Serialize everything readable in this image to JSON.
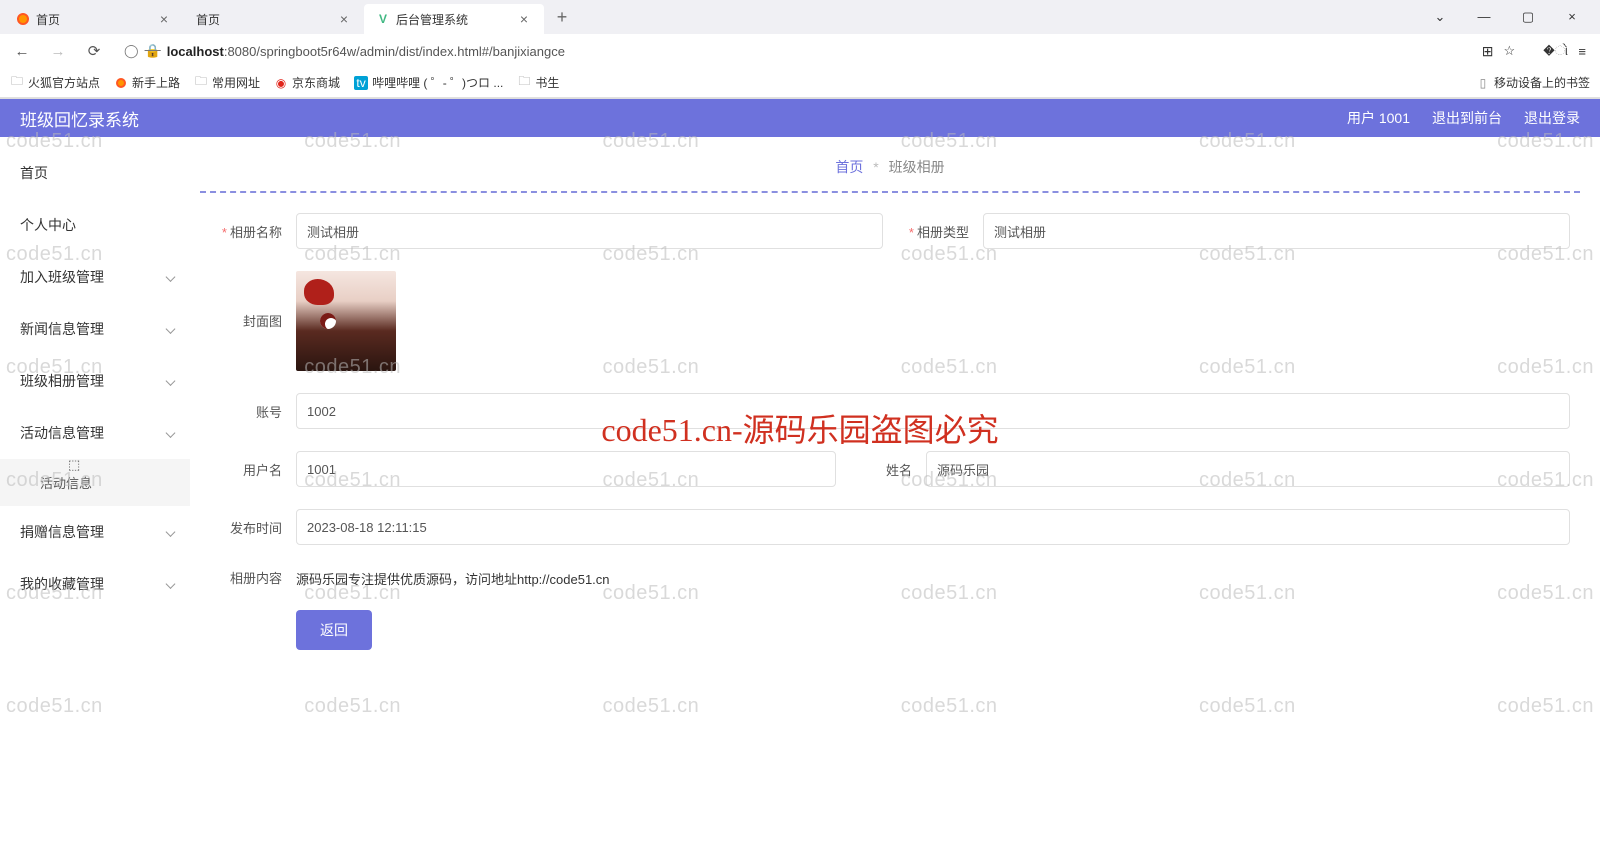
{
  "browser": {
    "tabs": [
      {
        "title": "首页",
        "favicon": "ff"
      },
      {
        "title": "首页",
        "favicon": "none"
      },
      {
        "title": "后台管理系统",
        "favicon": "vue",
        "active": true
      }
    ],
    "url_host": "localhost",
    "url_path": ":8080/springboot5r64w/admin/dist/index.html#/banjixiangce",
    "bookmarks": [
      {
        "label": "火狐官方站点",
        "icon": "folder"
      },
      {
        "label": "新手上路",
        "icon": "ff"
      },
      {
        "label": "常用网址",
        "icon": "folder"
      },
      {
        "label": "京东商城",
        "icon": "jd"
      },
      {
        "label": "哔哩哔哩 (  ゜- ゜)つロ ...",
        "icon": "bili"
      },
      {
        "label": "书生",
        "icon": "folder"
      }
    ],
    "mobile_bm": "移动设备上的书签"
  },
  "app": {
    "title": "班级回忆录系统",
    "user_label": "用户 1001",
    "exit_front": "退出到前台",
    "logout": "退出登录"
  },
  "sidebar": {
    "items": [
      {
        "label": "首页"
      },
      {
        "label": "个人中心"
      },
      {
        "label": "加入班级管理",
        "sub": true
      },
      {
        "label": "新闻信息管理",
        "sub": true
      },
      {
        "label": "班级相册管理",
        "sub": true
      },
      {
        "label": "活动信息管理",
        "sub": true
      },
      {
        "label": "捐赠信息管理",
        "sub": true
      },
      {
        "label": "我的收藏管理",
        "sub": true
      }
    ],
    "sub_active": "活动信息"
  },
  "breadcrumb": {
    "home": "首页",
    "current": "班级相册"
  },
  "form": {
    "album_name_label": "相册名称",
    "album_name_value": "测试相册",
    "album_type_label": "相册类型",
    "album_type_value": "测试相册",
    "cover_label": "封面图",
    "account_label": "账号",
    "account_value": "1002",
    "username_label": "用户名",
    "username_value": "1001",
    "realname_label": "姓名",
    "realname_value": "源码乐园",
    "publish_label": "发布时间",
    "publish_value": "2023-08-18 12:11:15",
    "content_label": "相册内容",
    "content_value": "源码乐园专注提供优质源码，访问地址http://code51.cn",
    "back_btn": "返回"
  },
  "watermark": {
    "text": "code51.cn",
    "center": "code51.cn-源码乐园盗图必究"
  }
}
